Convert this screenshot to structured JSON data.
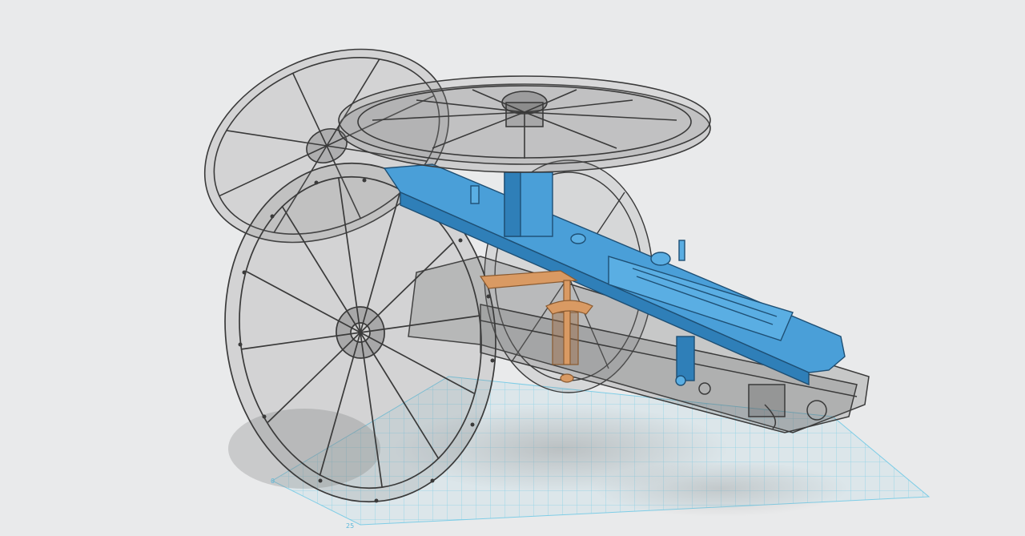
{
  "viewport": {
    "background": "#e9eaeb",
    "grid_labels": [
      "0",
      "25"
    ],
    "colors": {
      "ghost_line": "#3a3a3a",
      "ghost_fill": "rgba(120,120,120,0.22)",
      "selected_body": "#4a9fd8",
      "selected_dark": "#2f7fb8",
      "copper": "#d99a63",
      "grid": "#7fcde6"
    }
  },
  "model": {
    "parts": [
      {
        "name": "left-wheel",
        "state": "ghosted"
      },
      {
        "name": "right-wheel",
        "state": "ghosted"
      },
      {
        "name": "spare-wheel",
        "state": "ghosted"
      },
      {
        "name": "trail-carriage",
        "state": "ghosted"
      },
      {
        "name": "elevating-beam",
        "state": "selected"
      },
      {
        "name": "elevating-screw",
        "state": "highlighted"
      }
    ]
  }
}
